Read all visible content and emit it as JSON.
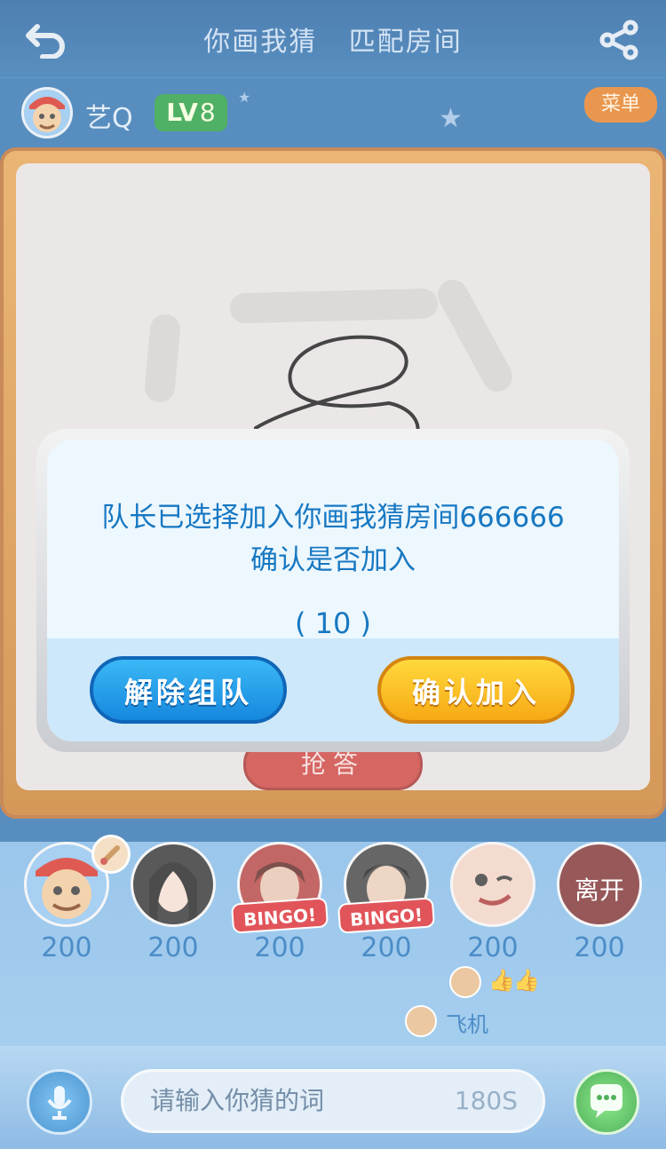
{
  "header": {
    "title_part1": "你画我猜",
    "title_part2": "匹配房间"
  },
  "user": {
    "name": "艺Q",
    "level_prefix": "LV",
    "level": "8",
    "menu_label": "菜单"
  },
  "board": {
    "grab_button": "抢答"
  },
  "dialog": {
    "line1": "队长已选择加入你画我猜房间666666",
    "line2": "确认是否加入",
    "countdown": "( 10 )",
    "cancel_label": "解除组队",
    "confirm_label": "确认加入"
  },
  "players": [
    {
      "score": "200",
      "badge": "",
      "status": ""
    },
    {
      "score": "200",
      "badge": "",
      "status": ""
    },
    {
      "score": "200",
      "badge": "BINGO!",
      "status": ""
    },
    {
      "score": "200",
      "badge": "BINGO!",
      "status": ""
    },
    {
      "score": "200",
      "badge": "",
      "status": ""
    },
    {
      "score": "200",
      "badge": "",
      "status": "离开"
    }
  ],
  "reactions": {
    "gift_name": "飞机"
  },
  "input": {
    "placeholder": "请输入你猜的词",
    "timer": "180S"
  },
  "icons": [
    "back-icon",
    "share-icon",
    "brush-icon",
    "thumbs-up-icon",
    "microphone-icon",
    "chat-icon"
  ],
  "colors": {
    "accent_blue": "#1778c2",
    "confirm_yellow": "#f7a915",
    "cancel_blue": "#1688de",
    "level_green": "#1f9a3a",
    "menu_orange": "#e37a1e"
  }
}
